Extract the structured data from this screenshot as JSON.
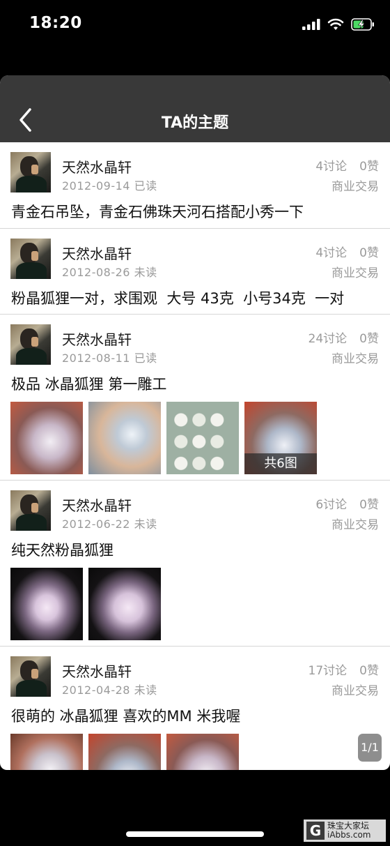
{
  "status_bar": {
    "time": "18:20"
  },
  "nav": {
    "title": "TA的主题"
  },
  "posts": [
    {
      "author": "天然水晶轩",
      "date": "2012-09-14",
      "read_status": "已读",
      "discussions": "4讨论",
      "likes": "0赞",
      "category": "商业交易",
      "title": "青金石吊坠，青金石佛珠天河石搭配小秀一下"
    },
    {
      "author": "天然水晶轩",
      "date": "2012-08-26",
      "read_status": "未读",
      "discussions": "4讨论",
      "likes": "0赞",
      "category": "商业交易",
      "title": "粉晶狐狸一对，求围观  大号 43克  小号34克  一对"
    },
    {
      "author": "天然水晶轩",
      "date": "2012-08-11",
      "read_status": "已读",
      "discussions": "24讨论",
      "likes": "0赞",
      "category": "商业交易",
      "title": "极品 冰晶狐狸 第一雕工",
      "more_label": "共6图"
    },
    {
      "author": "天然水晶轩",
      "date": "2012-06-22",
      "read_status": "未读",
      "discussions": "6讨论",
      "likes": "0赞",
      "category": "商业交易",
      "title": "纯天然粉晶狐狸"
    },
    {
      "author": "天然水晶轩",
      "date": "2012-04-28",
      "read_status": "未读",
      "discussions": "17讨论",
      "likes": "0赞",
      "category": "商业交易",
      "title": "很萌的 冰晶狐狸 喜欢的MM 米我喔"
    }
  ],
  "page_indicator": "1/1",
  "watermark": {
    "line1": "珠宝大家坛",
    "line2": "iAbbs.com"
  }
}
